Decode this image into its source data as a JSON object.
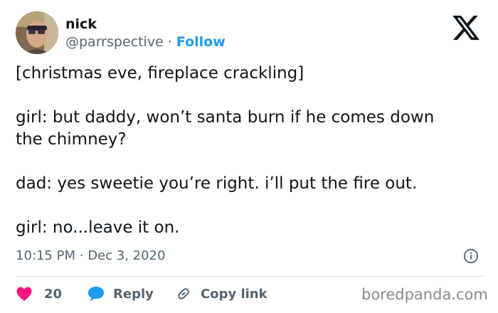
{
  "author": {
    "name": "nick",
    "handle": "@parrspective",
    "separator": "·",
    "follow_label": "Follow"
  },
  "tweet": {
    "lines": [
      "[christmas eve, fireplace crackling]",
      "girl: but daddy, won’t santa burn if he comes down",
      "the chimney?",
      "dad: yes sweetie you’re right. i’ll put the fire out.",
      "girl: no...leave it on."
    ]
  },
  "meta": {
    "time": "10:15 PM",
    "separator": "·",
    "date": "Dec 3, 2020"
  },
  "actions": {
    "like_count": "20",
    "reply_label": "Reply",
    "copy_link_label": "Copy link"
  },
  "watermark": "boredpanda.com",
  "icons": {
    "logo": "x-logo-icon",
    "info": "info-icon",
    "like": "heart-icon",
    "reply": "speech-bubble-icon",
    "copy": "link-icon"
  },
  "colors": {
    "accent": "#1d9bf0",
    "like": "#f91880",
    "muted": "#536471",
    "text": "#0f1419"
  }
}
